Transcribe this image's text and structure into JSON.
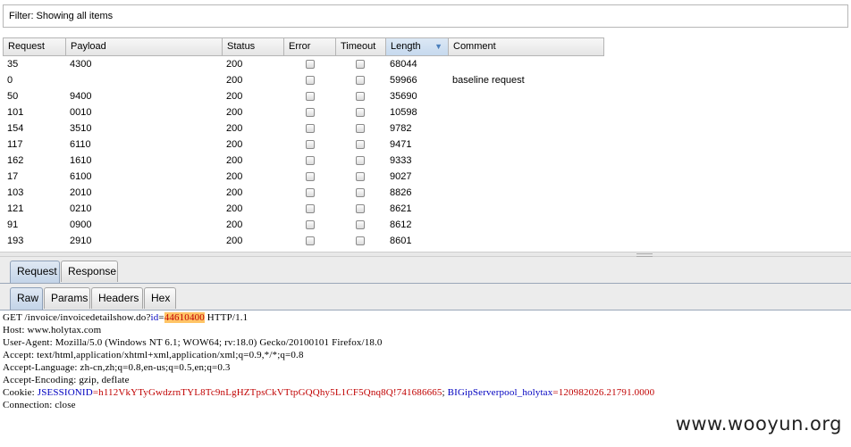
{
  "filter": {
    "text": "Filter: Showing all items"
  },
  "table": {
    "columns": [
      {
        "label": "Request"
      },
      {
        "label": "Payload"
      },
      {
        "label": "Status"
      },
      {
        "label": "Error"
      },
      {
        "label": "Timeout"
      },
      {
        "label": "Length"
      },
      {
        "label": "Comment"
      }
    ],
    "rows": [
      {
        "request": "35",
        "payload": "4300",
        "status": "200",
        "length": "68044",
        "comment": ""
      },
      {
        "request": "0",
        "payload": "",
        "status": "200",
        "length": "59966",
        "comment": "baseline request"
      },
      {
        "request": "50",
        "payload": "9400",
        "status": "200",
        "length": "35690",
        "comment": ""
      },
      {
        "request": "101",
        "payload": "0010",
        "status": "200",
        "length": "10598",
        "comment": ""
      },
      {
        "request": "154",
        "payload": "3510",
        "status": "200",
        "length": "9782",
        "comment": ""
      },
      {
        "request": "117",
        "payload": "6110",
        "status": "200",
        "length": "9471",
        "comment": ""
      },
      {
        "request": "162",
        "payload": "1610",
        "status": "200",
        "length": "9333",
        "comment": ""
      },
      {
        "request": "17",
        "payload": "6100",
        "status": "200",
        "length": "9027",
        "comment": ""
      },
      {
        "request": "103",
        "payload": "2010",
        "status": "200",
        "length": "8826",
        "comment": ""
      },
      {
        "request": "121",
        "payload": "0210",
        "status": "200",
        "length": "8621",
        "comment": ""
      },
      {
        "request": "91",
        "payload": "0900",
        "status": "200",
        "length": "8612",
        "comment": ""
      },
      {
        "request": "193",
        "payload": "2910",
        "status": "200",
        "length": "8601",
        "comment": ""
      }
    ]
  },
  "tabs_top": [
    {
      "label": "Request"
    },
    {
      "label": "Response"
    }
  ],
  "tabs_view": [
    {
      "label": "Raw"
    },
    {
      "label": "Params"
    },
    {
      "label": "Headers"
    },
    {
      "label": "Hex"
    }
  ],
  "raw": {
    "line1_pre": "GET /invoice/invoicedetailshow.do?",
    "line1_param": "id",
    "line1_eq": "=",
    "line1_value": "44610400",
    "line1_post": " HTTP/1.1",
    "host": "Host: www.holytax.com",
    "user_agent": "User-Agent: Mozilla/5.0 (Windows NT 6.1; WOW64; rv:18.0) Gecko/20100101 Firefox/18.0",
    "accept": "Accept: text/html,application/xhtml+xml,application/xml;q=0.9,*/*;q=0.8",
    "accept_language": "Accept-Language: zh-cn,zh;q=0.8,en-us;q=0.5,en;q=0.3",
    "accept_encoding": "Accept-Encoding: gzip, deflate",
    "cookie_label": "Cookie: ",
    "cookie1_name": "JSESSIONID",
    "cookie1_value": "=h112VkYTyGwdzrnTYL8Tc9nLgHZTpsCkVTtpGQQhy5L1CF5Qnq8Q!741686665",
    "cookie_sep": "; ",
    "cookie2_name": "BIGipServerpool_holytax",
    "cookie2_value": "=120982026.21791.0000",
    "connection": "Connection: close"
  },
  "watermark": "www.wooyun.org"
}
